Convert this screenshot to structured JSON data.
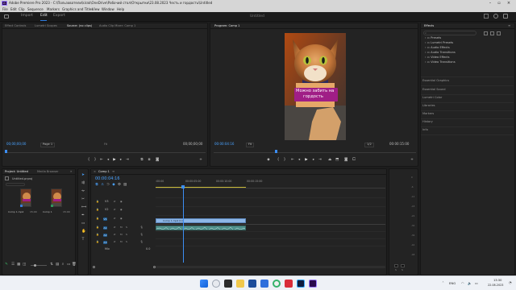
{
  "titlebar": {
    "title": "Adobe Premiere Pro 2023 - C:\\Пользователи\\kirak\\OneDrive\\Рабочий стол\\Открытки\\23.08.2023 Честь и гордость\\Untitled",
    "app_icon": "Pr"
  },
  "menu": [
    "File",
    "Edit",
    "Clip",
    "Sequence",
    "Markers",
    "Graphics and Titles",
    "View",
    "Window",
    "Help"
  ],
  "workspace": {
    "tabs": [
      "Import",
      "Edit",
      "Export"
    ],
    "title": "Untitled"
  },
  "source_panel": {
    "tabs": [
      "Effect Controls",
      "Lumetri Scopes",
      "Source: (no clips)",
      "Audio Clip Mixer: Comp 1"
    ],
    "timecode_left": "00;00;00;00",
    "zoom": "Page 1",
    "timecode_right": "00;00;00;00",
    "fit_small": "Fit"
  },
  "program_panel": {
    "tab": "Program: Comp 1",
    "timecode_left": "00:00:04:16",
    "fit": "Fit",
    "resolution": "1/2",
    "timecode_right": "00:00:15:00",
    "caption_line1": "Можно забить на",
    "caption_line2": "гордость",
    "playhead_fraction": 0.31
  },
  "effects_panel": {
    "tab": "Effects",
    "folders": [
      "Presets",
      "Lumetri Presets",
      "Audio Effects",
      "Audio Transitions",
      "Video Effects",
      "Video Transitions"
    ],
    "sections": [
      "Essential Graphics",
      "Essential Sound",
      "Lumetri Color",
      "Libraries",
      "Markers",
      "History",
      "Info"
    ]
  },
  "project_panel": {
    "tabs": [
      "Project: Untitled",
      "Media Browser"
    ],
    "project_name": "Untitled.prproj",
    "items": [
      {
        "name": "Comp 1.mp4",
        "duration": "15;00"
      },
      {
        "name": "Comp 1",
        "duration": "15:00"
      }
    ]
  },
  "timeline": {
    "tab": "Comp 1",
    "timecode": "00:00:04:16",
    "ruler_ticks": [
      ":00:00",
      "00:00:05:00",
      "00:00:10:00",
      "00:00:15:00"
    ],
    "tracks": [
      {
        "id": "V3",
        "kind": "video"
      },
      {
        "id": "V2",
        "kind": "video"
      },
      {
        "id": "V1",
        "kind": "video"
      },
      {
        "id": "A1",
        "kind": "audio"
      },
      {
        "id": "A2",
        "kind": "audio"
      },
      {
        "id": "A3",
        "kind": "audio"
      }
    ],
    "mix_label": "Mix",
    "mix_value": "0.0",
    "video_clip": "Comp 1.mp4 [V]",
    "playhead_fraction": 0.31
  },
  "taskbar": {
    "lang": "ENG",
    "time": "13:30",
    "date": "22.08.2023"
  },
  "colors": {
    "accent": "#2f7de1",
    "video_clip": "#8db6e6",
    "audio_clip": "#4f8f8a",
    "caption_bg": "#a01e86"
  }
}
